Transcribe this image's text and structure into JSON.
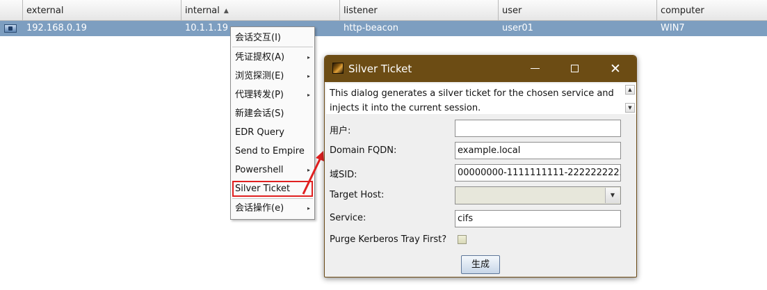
{
  "table": {
    "columns": [
      "external",
      "internal",
      "listener",
      "user",
      "computer"
    ],
    "sorted_column": "internal",
    "sort_direction": "ascending",
    "rows": [
      {
        "external": "192.168.0.19",
        "internal": "10.1.1.19",
        "listener": "http-beacon",
        "user": "user01",
        "computer": "WIN7"
      }
    ]
  },
  "context_menu": {
    "items": [
      {
        "label": "会话交互(I)",
        "has_submenu": false
      },
      {
        "label": "凭证提权(A)",
        "has_submenu": true
      },
      {
        "label": "浏览探测(E)",
        "has_submenu": true
      },
      {
        "label": "代理转发(P)",
        "has_submenu": true
      },
      {
        "label": "新建会话(S)",
        "has_submenu": false
      },
      {
        "label": "EDR Query",
        "has_submenu": false
      },
      {
        "label": "Send to Empire",
        "has_submenu": false
      },
      {
        "label": "Powershell",
        "has_submenu": true
      },
      {
        "label": "Silver Ticket",
        "has_submenu": false,
        "highlighted": true
      },
      {
        "label": "会话操作(e)",
        "has_submenu": true
      }
    ]
  },
  "dialog": {
    "title": "Silver Ticket",
    "description": "This dialog generates a silver ticket for the chosen service and injects it into the current session.",
    "fields": {
      "user": {
        "label": "用户:",
        "value": ""
      },
      "domain": {
        "label": "Domain FQDN:",
        "value": "example.local"
      },
      "sid": {
        "label": "域SID:",
        "value": "00000000-1111111111-2222222222"
      },
      "target_host": {
        "label": "Target Host:",
        "value": ""
      },
      "service": {
        "label": "Service:",
        "value": "cifs"
      },
      "purge": {
        "label": "Purge Kerberos Tray First?",
        "checked": false
      }
    },
    "submit_label": "生成"
  },
  "colors": {
    "titlebar": "#6c4c14",
    "selected_row": "#7d9ec0",
    "annotation": "#e02020"
  },
  "icons": {
    "row": "beacon-host-icon",
    "title": "cobalt-strike-icon",
    "minimize": "minimize-icon",
    "maximize": "maximize-icon",
    "close": "close-icon"
  }
}
